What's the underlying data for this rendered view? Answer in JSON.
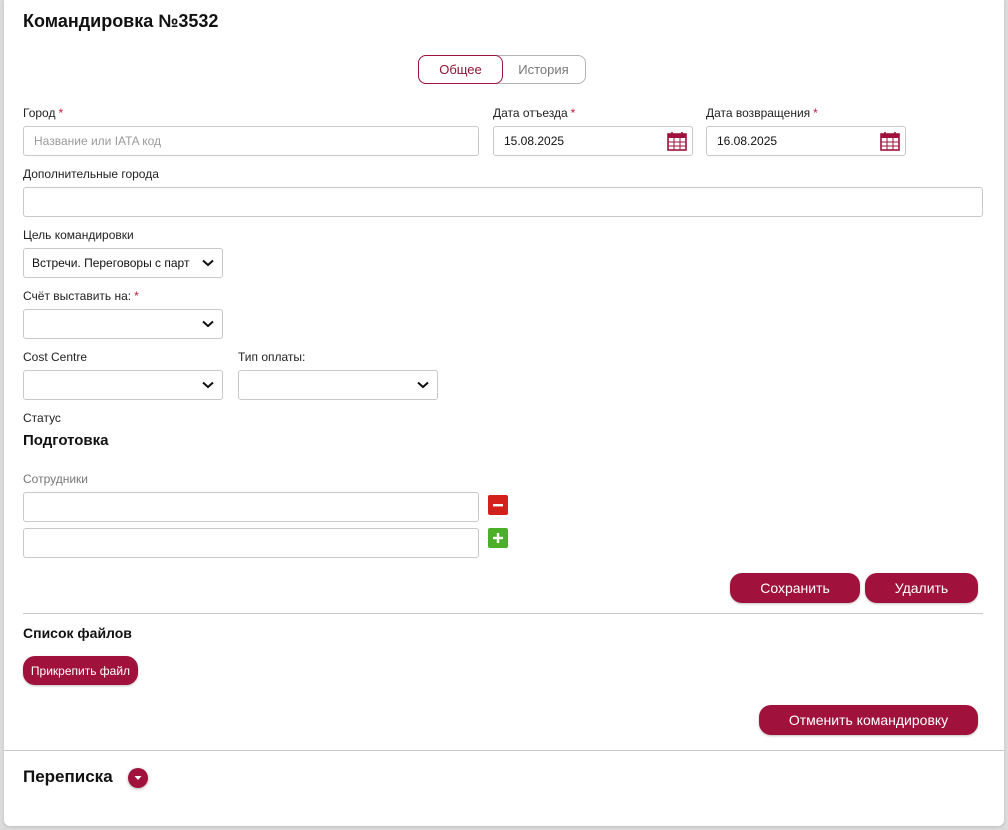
{
  "page": {
    "title": "Командировка №3532"
  },
  "tabs": [
    {
      "label": "Общее",
      "active": true
    },
    {
      "label": "История",
      "active": false
    }
  ],
  "form": {
    "city": {
      "label": "Город",
      "required_mark": "*",
      "placeholder": "Название или IATA код",
      "value": ""
    },
    "departure_date": {
      "label": "Дата отъезда",
      "required_mark": "*",
      "value": "15.08.2025"
    },
    "return_date": {
      "label": "Дата возвращения",
      "required_mark": "*",
      "value": "16.08.2025"
    },
    "extra_cities": {
      "label": "Дополнительные города",
      "value": ""
    },
    "purpose": {
      "label": "Цель командировки",
      "selected": "Встречи. Переговоры с парт"
    },
    "invoice_to": {
      "label": "Счёт выставить на:",
      "required_mark": "*",
      "selected": ""
    },
    "cost_centre": {
      "label": "Cost Centre",
      "selected": ""
    },
    "payment_type": {
      "label": "Тип оплаты:",
      "selected": ""
    },
    "status": {
      "label": "Статус",
      "value": "Подготовка"
    },
    "employees": {
      "label": "Сотрудники",
      "rows": [
        "",
        ""
      ]
    }
  },
  "actions": {
    "save_label": "Сохранить",
    "delete_label": "Удалить",
    "cancel_trip_label": "Отменить командировку"
  },
  "files": {
    "title": "Список файлов",
    "attach_label": "Прикрепить файл"
  },
  "correspondence": {
    "title": "Переписка"
  },
  "colors": {
    "accent": "#a0123c",
    "remove": "#d4201b",
    "add": "#4caf29"
  },
  "icons": {
    "calendar": "calendar-icon",
    "chevron": "chevron-down-icon",
    "minus": "minus-icon",
    "plus": "plus-icon"
  }
}
